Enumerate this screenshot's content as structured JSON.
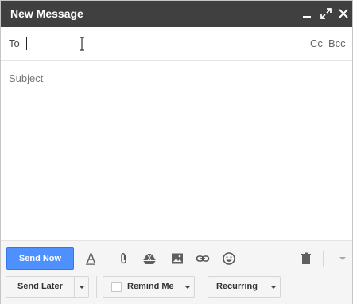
{
  "window": {
    "title": "New Message",
    "controls": [
      "minimize-icon",
      "expand-icon",
      "close-icon"
    ]
  },
  "to": {
    "label": "To",
    "value": "",
    "cc_label": "Cc",
    "bcc_label": "Bcc"
  },
  "subject": {
    "placeholder": "Subject",
    "value": ""
  },
  "body": {
    "value": ""
  },
  "toolbar": {
    "send_now_label": "Send Now",
    "icons": [
      "formatting-icon",
      "attach-icon",
      "drive-icon",
      "photo-icon",
      "link-icon",
      "emoji-icon",
      "trash-icon",
      "more-options-icon"
    ]
  },
  "actions": {
    "send_later_label": "Send Later",
    "remind_me_label": "Remind Me",
    "remind_me_checked": false,
    "recurring_label": "Recurring"
  },
  "colors": {
    "titlebar": "#404040",
    "send_button": "#4d90fe",
    "footer": "#f5f5f5"
  }
}
